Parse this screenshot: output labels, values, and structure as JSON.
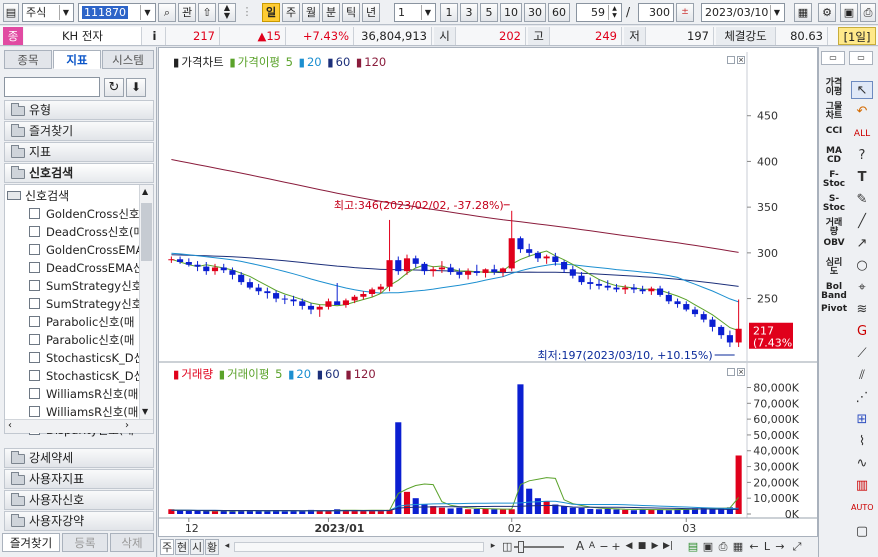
{
  "toolbar": {
    "market": "주식",
    "code": "111870",
    "btn_gwan": "관",
    "period_day": "일",
    "period_week": "주",
    "period_month": "월",
    "period_min": "분",
    "period_tick": "틱",
    "period_year": "년",
    "multiplier": "1",
    "quick": [
      "1",
      "3",
      "5",
      "10",
      "30",
      "60"
    ],
    "count": "59",
    "slash": "/",
    "total": "300",
    "date": "2023/03/10"
  },
  "quote": {
    "badge": "종",
    "name": "KH 전자",
    "info": "i",
    "price": "217",
    "change": "▲15",
    "change_pct": "+7.43%",
    "volume": "36,804,913",
    "open_label": "시",
    "open": "202",
    "high_label": "고",
    "high": "249",
    "low_label": "저",
    "low": "197",
    "strength_label": "체결강도",
    "strength": "80.63",
    "period_badge": "[1일]"
  },
  "left": {
    "tabs": [
      "종목",
      "지표",
      "시스템"
    ],
    "folders_top": [
      "유형",
      "즐겨찾기",
      "지표",
      "신호검색"
    ],
    "tree_root": "신호검색",
    "tree_items": [
      "GoldenCross신호",
      "DeadCross신호(매",
      "GoldenCrossEMA",
      "DeadCrossEMA신",
      "SumStrategy신호",
      "SumStrategy신호",
      "Parabolic신호(매",
      "Parabolic신호(매",
      "StochasticsK_D신",
      "StochasticsK_D신",
      "WilliamsR신호(매",
      "WilliamsR신호(매",
      "Disparity신호(매"
    ],
    "folders_bottom": [
      "강세약세",
      "사용자지표",
      "사용자신호",
      "사용자강약"
    ],
    "bottom_tabs": [
      "즐겨찾기",
      "등록",
      "삭제"
    ]
  },
  "price_legend": {
    "title": "가격차트",
    "ma_label": "가격이평",
    "ma": [
      "5",
      "20",
      "60",
      "120"
    ]
  },
  "volume_legend": {
    "title": "거래량",
    "ma_label": "거래이평",
    "ma": [
      "5",
      "20",
      "60",
      "120"
    ]
  },
  "colors": {
    "up": "#e0001b",
    "down": "#0b1fd1",
    "ma5": "#5aa22a",
    "ma20": "#1c8fd0",
    "ma60": "#1c2f7a",
    "ma120": "#8a1c3c"
  },
  "chart_data": {
    "type": "candlestick",
    "title": "가격차트",
    "price_axis": {
      "ticks": [
        250,
        300,
        350,
        400,
        450
      ]
    },
    "volume_axis": {
      "ticks": [
        "0K",
        "10,000K",
        "20,000K",
        "30,000K",
        "40,000K",
        "50,000K",
        "60,000K",
        "70,000K",
        "80,000K"
      ]
    },
    "x_labels": [
      "12",
      "2023/01",
      "02",
      "03"
    ],
    "annotations": {
      "high": "최고:346(2023/02/02, -37.28%)",
      "low": "최저:197(2023/03/10, +10.15%)",
      "last_price": "217",
      "last_pct": "(7.43%)"
    },
    "candles": [
      [
        292,
        296,
        289,
        293
      ],
      [
        293,
        296,
        288,
        290
      ],
      [
        290,
        294,
        285,
        287
      ],
      [
        287,
        291,
        280,
        285
      ],
      [
        285,
        290,
        276,
        280
      ],
      [
        280,
        288,
        276,
        284
      ],
      [
        284,
        288,
        278,
        281
      ],
      [
        281,
        284,
        271,
        276
      ],
      [
        276,
        279,
        265,
        268
      ],
      [
        268,
        272,
        260,
        262
      ],
      [
        262,
        266,
        254,
        258
      ],
      [
        258,
        262,
        250,
        256
      ],
      [
        256,
        259,
        246,
        250
      ],
      [
        250,
        254,
        244,
        249
      ],
      [
        249,
        253,
        242,
        247
      ],
      [
        247,
        250,
        238,
        242
      ],
      [
        242,
        245,
        233,
        238
      ],
      [
        238,
        243,
        230,
        241
      ],
      [
        241,
        250,
        238,
        247
      ],
      [
        247,
        267,
        244,
        243
      ],
      [
        243,
        250,
        240,
        248
      ],
      [
        248,
        254,
        245,
        252
      ],
      [
        252,
        258,
        249,
        255
      ],
      [
        255,
        262,
        252,
        260
      ],
      [
        260,
        266,
        256,
        263
      ],
      [
        263,
        336,
        258,
        292
      ],
      [
        292,
        296,
        276,
        280
      ],
      [
        280,
        298,
        276,
        294
      ],
      [
        294,
        297,
        284,
        288
      ],
      [
        288,
        290,
        276,
        280
      ],
      [
        280,
        285,
        274,
        282
      ],
      [
        282,
        291,
        278,
        284
      ],
      [
        284,
        288,
        276,
        279
      ],
      [
        279,
        283,
        272,
        276
      ],
      [
        276,
        283,
        271,
        280
      ],
      [
        280,
        287,
        275,
        278
      ],
      [
        278,
        283,
        273,
        282
      ],
      [
        282,
        287,
        276,
        279
      ],
      [
        279,
        284,
        274,
        283
      ],
      [
        283,
        346,
        280,
        316
      ],
      [
        316,
        318,
        300,
        304
      ],
      [
        304,
        310,
        296,
        300
      ],
      [
        300,
        302,
        290,
        294
      ],
      [
        294,
        298,
        288,
        296
      ],
      [
        296,
        300,
        286,
        290
      ],
      [
        290,
        292,
        278,
        282
      ],
      [
        282,
        286,
        272,
        275
      ],
      [
        275,
        279,
        265,
        268
      ],
      [
        268,
        273,
        260,
        266
      ],
      [
        266,
        271,
        260,
        264
      ],
      [
        264,
        270,
        259,
        262
      ],
      [
        262,
        266,
        257,
        260
      ],
      [
        260,
        265,
        255,
        262
      ],
      [
        262,
        266,
        256,
        260
      ],
      [
        260,
        264,
        255,
        258
      ],
      [
        258,
        263,
        254,
        261
      ],
      [
        261,
        264,
        252,
        254
      ],
      [
        254,
        258,
        244,
        247
      ],
      [
        247,
        250,
        240,
        244
      ],
      [
        244,
        247,
        236,
        238
      ],
      [
        238,
        241,
        230,
        233
      ],
      [
        233,
        236,
        224,
        227
      ],
      [
        227,
        230,
        214,
        219
      ],
      [
        219,
        221,
        206,
        210
      ],
      [
        210,
        215,
        197,
        202
      ],
      [
        202,
        249,
        197,
        217
      ]
    ],
    "volumes": [
      3,
      2.5,
      2,
      2.2,
      2,
      1.8,
      2,
      1.6,
      2.4,
      2.2,
      2,
      1.8,
      2.5,
      1.6,
      2,
      1.8,
      2.6,
      2,
      2.2,
      3,
      2.4,
      2.2,
      2,
      2.4,
      2.2,
      2.6,
      58,
      14,
      10,
      6,
      5,
      4,
      3.5,
      4,
      3,
      3.2,
      3.4,
      3,
      2.8,
      3,
      82,
      16,
      10,
      8,
      6,
      5,
      4,
      3.8,
      3.2,
      3,
      3.2,
      2.8,
      2.6,
      2.4,
      2.8,
      3,
      2.6,
      2.4,
      3,
      3.2,
      3.6,
      4,
      3.4,
      3.8,
      4.2,
      37
    ],
    "ma5_volume": [
      2.5,
      2.4,
      2.3,
      2.2,
      2.1,
      2,
      2,
      1.9,
      2,
      2,
      2,
      1.9,
      2.1,
      2,
      2,
      1.9,
      2.1,
      2,
      2.1,
      2.3,
      2.4,
      2.4,
      2.3,
      2.4,
      2.4,
      2.3,
      13,
      15.8,
      18,
      19,
      18.6,
      7.8,
      5.5,
      4.6,
      4,
      3.6,
      3.4,
      3.2,
      3.1,
      3.1,
      18.6,
      21,
      22,
      23,
      22.5,
      9,
      6.6,
      5.4,
      4.4,
      3.8,
      3.5,
      3.2,
      3,
      2.9,
      2.9,
      2.8,
      2.8,
      2.7,
      2.8,
      2.9,
      3,
      3.2,
      3.4,
      3.6,
      3.8,
      10.5
    ],
    "ma20_volume": [
      2.4,
      2.4,
      2.4,
      2.3,
      2.3,
      2.3,
      2.2,
      2.2,
      2.2,
      2.2,
      2.1,
      2.1,
      2.1,
      2.1,
      2.1,
      2,
      2,
      2,
      2,
      2,
      2.1,
      2.1,
      2.1,
      2.1,
      2.1,
      2.2,
      5,
      5.6,
      6,
      6.2,
      6.4,
      6.5,
      6.6,
      6.6,
      6.7,
      6.8,
      6.8,
      6.9,
      6.9,
      6.9,
      7,
      7.5,
      7.8,
      8,
      8.1,
      7.2,
      6.2,
      6,
      6,
      6,
      6,
      6,
      5.8,
      5.6,
      5.4,
      5.2,
      5,
      4.8,
      4.6,
      4.4,
      4.2,
      4,
      3.8,
      3.6,
      3.4,
      3.6
    ]
  },
  "right": {
    "labels": [
      "가격\n이평",
      "그물\n차트",
      "CCI",
      "MA\nCD",
      "F-\nStoc",
      "S-\nStoc",
      "거래\n량",
      "OBV",
      "심리\n도",
      "Bol\nBand",
      "Pivot"
    ]
  },
  "bottom": {
    "tabs": [
      "주",
      "현",
      "시",
      "황"
    ],
    "font_a_big": "A",
    "font_a_small": "A"
  }
}
